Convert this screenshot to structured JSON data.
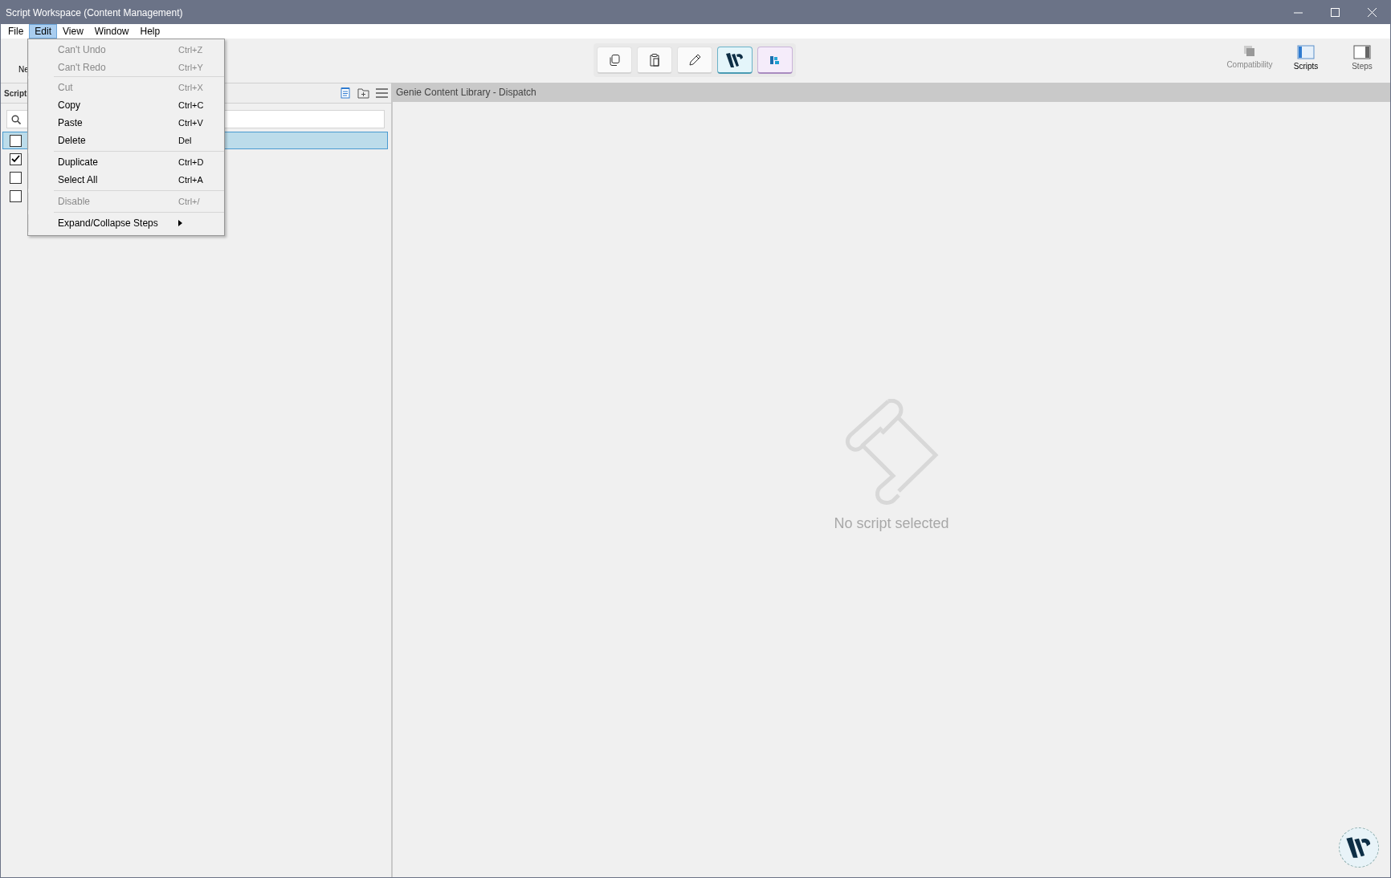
{
  "window": {
    "title": "Script Workspace (Content Management)"
  },
  "menu_bar": [
    {
      "label": "File",
      "selected": false
    },
    {
      "label": "Edit",
      "selected": true
    },
    {
      "label": "View",
      "selected": false
    },
    {
      "label": "Window",
      "selected": false
    },
    {
      "label": "Help",
      "selected": false
    }
  ],
  "edit_menu": [
    [
      {
        "label": "Can't Undo",
        "shortcut": "Ctrl+Z",
        "disabled": true
      },
      {
        "label": "Can't Redo",
        "shortcut": "Ctrl+Y",
        "disabled": true
      }
    ],
    [
      {
        "label": "Cut",
        "shortcut": "Ctrl+X",
        "disabled": true
      },
      {
        "label": "Copy",
        "shortcut": "Ctrl+C",
        "disabled": false
      },
      {
        "label": "Paste",
        "shortcut": "Ctrl+V",
        "disabled": false
      },
      {
        "label": "Delete",
        "shortcut": "Del",
        "disabled": false
      }
    ],
    [
      {
        "label": "Duplicate",
        "shortcut": "Ctrl+D",
        "disabled": false
      },
      {
        "label": "Select All",
        "shortcut": "Ctrl+A",
        "disabled": false
      }
    ],
    [
      {
        "label": "Disable",
        "shortcut": "Ctrl+/",
        "disabled": true
      }
    ],
    [
      {
        "label": "Expand/Collapse Steps",
        "submenu": true,
        "disabled": false
      }
    ]
  ],
  "toolbar": {
    "left_button": "Ne",
    "center_buttons": [
      {
        "kind": "copy",
        "selected": false
      },
      {
        "kind": "paste",
        "selected": false
      },
      {
        "kind": "edit",
        "selected": false
      },
      {
        "kind": "logo",
        "selected": true
      },
      {
        "kind": "app",
        "selected": false
      }
    ],
    "view_buttons": [
      {
        "label": "Compatibility",
        "kind": "stack",
        "selected": false,
        "disabled": true
      },
      {
        "label": "Scripts",
        "kind": "left-pane",
        "selected": true,
        "disabled": false
      },
      {
        "label": "Steps",
        "kind": "right-pane",
        "selected": false,
        "disabled": false
      }
    ]
  },
  "scripts_panel": {
    "title": "Script",
    "rows": [
      {
        "checked": false,
        "selected": true
      },
      {
        "checked": true,
        "selected": false
      },
      {
        "checked": false,
        "selected": false
      },
      {
        "checked": false,
        "selected": false
      }
    ]
  },
  "main_panel": {
    "title": "Genie Content Library - Dispatch",
    "empty_message": "No script selected"
  }
}
